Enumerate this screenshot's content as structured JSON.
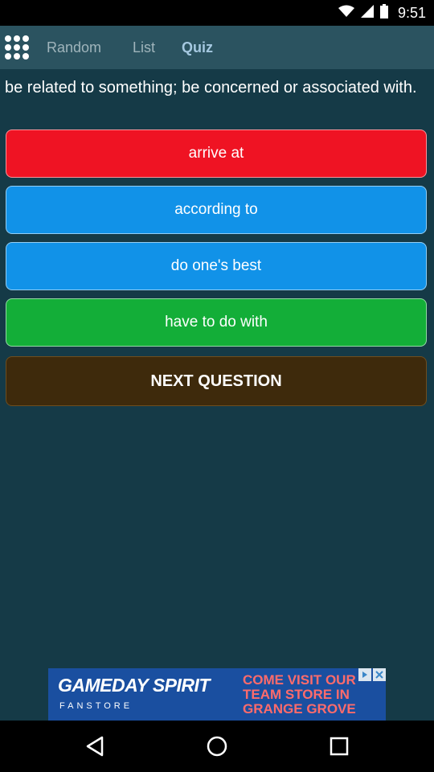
{
  "status": {
    "time": "9:51"
  },
  "tabs": [
    {
      "label": "Random",
      "active": false
    },
    {
      "label": "List",
      "active": false
    },
    {
      "label": "Quiz",
      "active": true
    }
  ],
  "icons": {
    "menu": "grid-menu-icon",
    "wifi": "wifi-icon",
    "cellular": "cellular-signal-icon",
    "battery": "battery-icon",
    "back": "back-icon",
    "home": "home-icon",
    "recents": "recents-icon"
  },
  "question": {
    "text": "be related to something; be concerned or associated with."
  },
  "answers": [
    {
      "label": "arrive at",
      "state": "wrong",
      "color": "#ef1323"
    },
    {
      "label": "according to",
      "state": "neutral",
      "color": "#1192e8"
    },
    {
      "label": "do one's best",
      "state": "neutral",
      "color": "#1192e8"
    },
    {
      "label": "have to do with",
      "state": "correct",
      "color": "#13ae38"
    }
  ],
  "next_button": {
    "label": "NEXT QUESTION",
    "color": "#3e2a0c"
  },
  "ad": {
    "brand": "GAMEDAY SPIRIT",
    "brand_sub": "FANSTORE",
    "text": "COME VISIT OUR TEAM STORE IN GRANGE GROVE"
  },
  "colors": {
    "background": "#153a47",
    "topbar": "#2b5360",
    "active_tab": "#a5c8e0"
  }
}
